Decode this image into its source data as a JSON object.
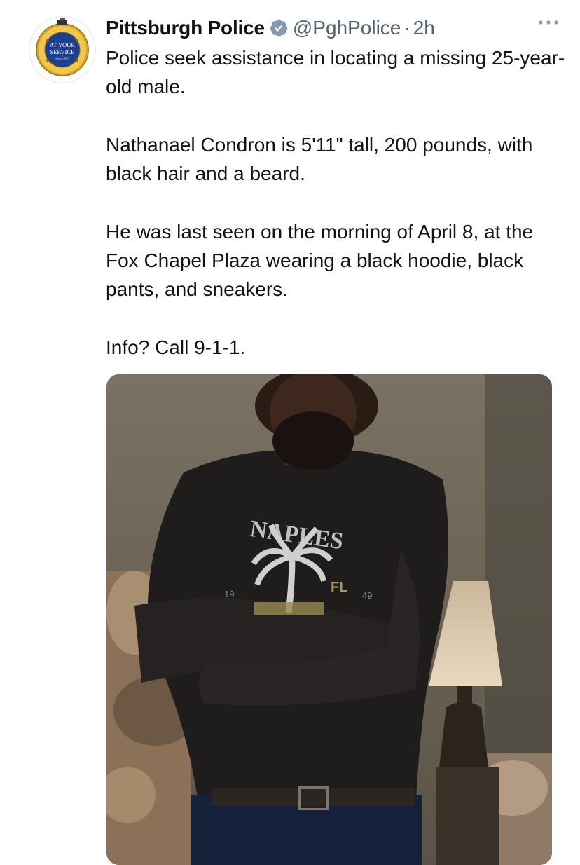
{
  "tweet": {
    "display_name": "Pittsburgh Police",
    "handle": "@PghPolice",
    "separator": "·",
    "time": "2h",
    "paragraphs": [
      "Police seek assistance in locating a missing 25-year-old male.",
      "Nathanael Condron is 5'11\" tall, 200 pounds, with black hair and a beard.",
      "He was last seen on the morning of April 8, at the Fox Chapel Plaza wearing a black hoodie, black pants, and sneakers.",
      "Info? Call 9-1-1."
    ]
  },
  "avatar": {
    "badge_text_1": "AT YOUR",
    "badge_text_2": "SERVICE",
    "badge_text_3": "Since 1857",
    "ring_color": "#d8a72a",
    "center_color": "#1d3f8f"
  },
  "photo": {
    "shirt_print_top": "NAPLES",
    "shirt_print_fl": "FL",
    "shirt_num_left": "19",
    "shirt_num_right": "49"
  },
  "icons": {
    "verified": "verified-badge-icon",
    "more": "more-horizontal-icon"
  },
  "colors": {
    "text": "#0f1419",
    "secondary": "#536471",
    "verified_badge": "#829aab"
  }
}
